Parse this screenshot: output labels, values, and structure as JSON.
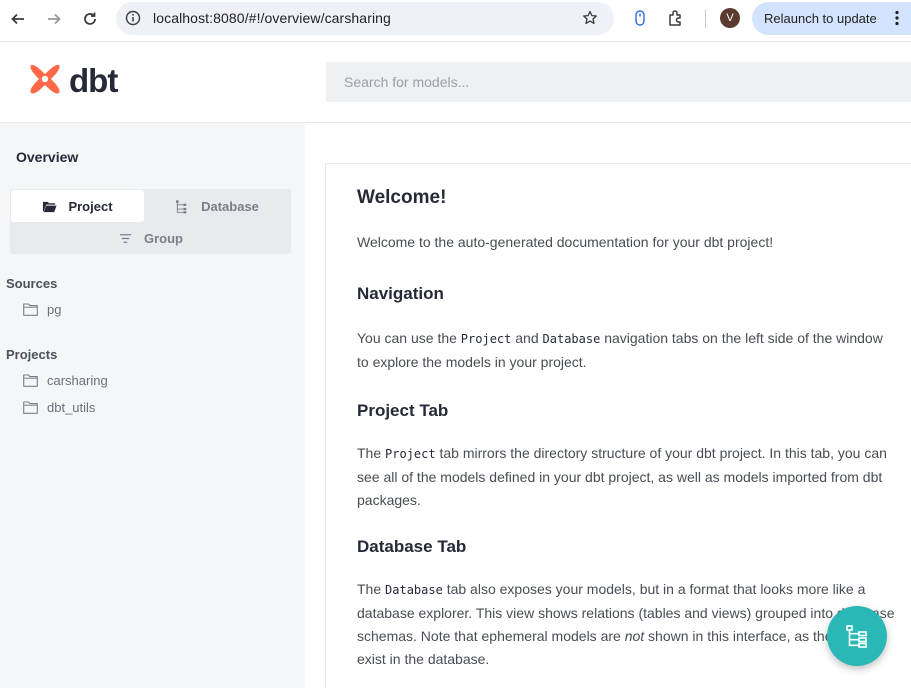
{
  "browser": {
    "url": "localhost:8080/#!/overview/carsharing",
    "avatar_letter": "V",
    "relaunch_label": "Relaunch to update"
  },
  "header": {
    "logo_text": "dbt",
    "search_placeholder": "Search for models...",
    "brand_color": "#ff694a"
  },
  "sidebar": {
    "overview_label": "Overview",
    "tabs": {
      "project": "Project",
      "database": "Database",
      "group": "Group"
    },
    "sources_title": "Sources",
    "sources": [
      "pg"
    ],
    "projects_title": "Projects",
    "projects": [
      "carsharing",
      "dbt_utils"
    ]
  },
  "main": {
    "welcome_title": "Welcome!",
    "welcome_text": "Welcome to the auto-generated documentation for your dbt project!",
    "navigation_title": "Navigation",
    "navigation_text": {
      "a": "You can use the ",
      "code1": "Project",
      "b": " and ",
      "code2": "Database",
      "c": " navigation tabs on the left side of the window to explore the models in your project."
    },
    "project_tab_title": "Project Tab",
    "project_tab_text": {
      "a": "The ",
      "code": "Project",
      "b": " tab mirrors the directory structure of your dbt project. In this tab, you can see all of the models defined in your dbt project, as well as models imported from dbt packages."
    },
    "database_tab_title": "Database Tab",
    "database_tab_text": {
      "a": "The ",
      "code": "Database",
      "b": " tab also exposes your models, but in a format that looks more like a database explorer. This view shows relations (tables and views) grouped into database schemas. Note that ephemeral models are ",
      "em": "not",
      "c": " shown in this interface, as they do not exist in the database."
    }
  },
  "fab": {
    "color": "#2ab8b6",
    "icon": "lineage-graph-icon"
  }
}
